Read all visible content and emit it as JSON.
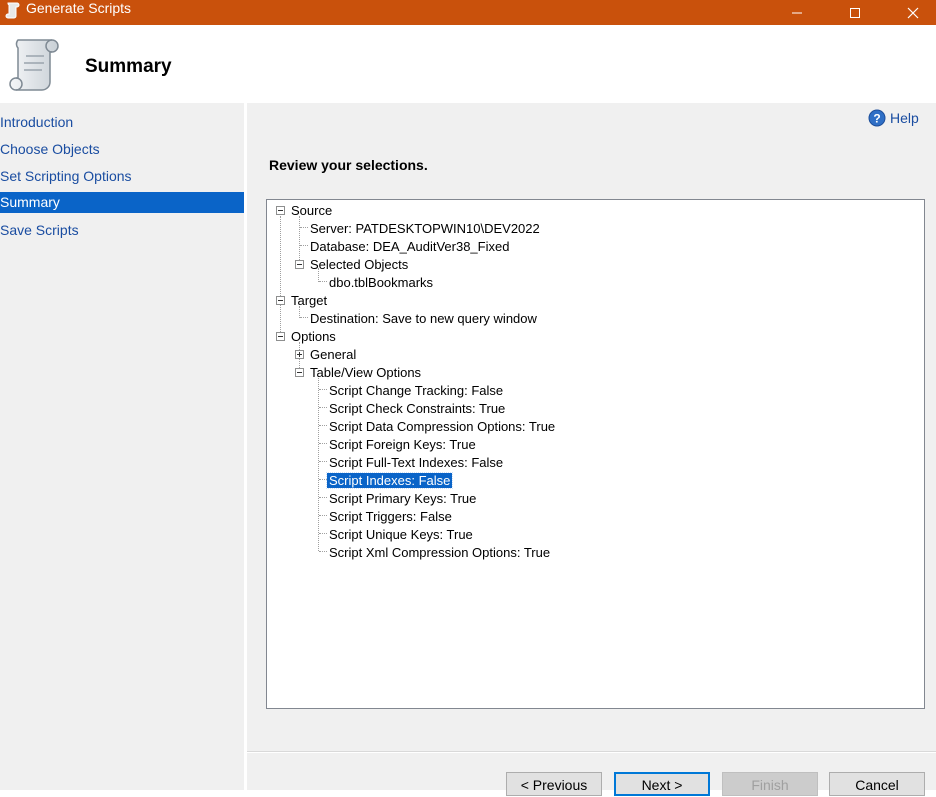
{
  "window": {
    "title": "Generate Scripts",
    "titlebar_color": "#c9510c"
  },
  "header": {
    "title": "Summary",
    "icon": "scroll-icon"
  },
  "nav": {
    "items": [
      {
        "label": "Introduction"
      },
      {
        "label": "Choose Objects"
      },
      {
        "label": "Set Scripting Options"
      },
      {
        "label": "Summary",
        "selected": true
      },
      {
        "label": "Save Scripts"
      }
    ]
  },
  "main": {
    "help_label": "Help",
    "review_label": "Review your selections."
  },
  "tree": {
    "source": "Source",
    "server": "Server: PATDESKTOPWIN10\\DEV2022",
    "database": "Database: DEA_AuditVer38_Fixed",
    "selected_objects": "Selected Objects",
    "object": "dbo.tblBookmarks",
    "target": "Target",
    "destination": "Destination: Save to new query window",
    "options": "Options",
    "general": "General",
    "table_view_options": "Table/View Options",
    "table_options": [
      "Script Change Tracking: False",
      "Script Check Constraints: True",
      "Script Data Compression Options: True",
      "Script Foreign Keys: True",
      "Script Full-Text Indexes: False",
      "Script Indexes: False",
      "Script Primary Keys: True",
      "Script Triggers: False",
      "Script Unique Keys: True",
      "Script Xml Compression Options: True"
    ],
    "selected_option": "Script Indexes: False"
  },
  "buttons": {
    "previous": "< Previous",
    "next": "Next >",
    "finish": "Finish",
    "cancel": "Cancel"
  }
}
